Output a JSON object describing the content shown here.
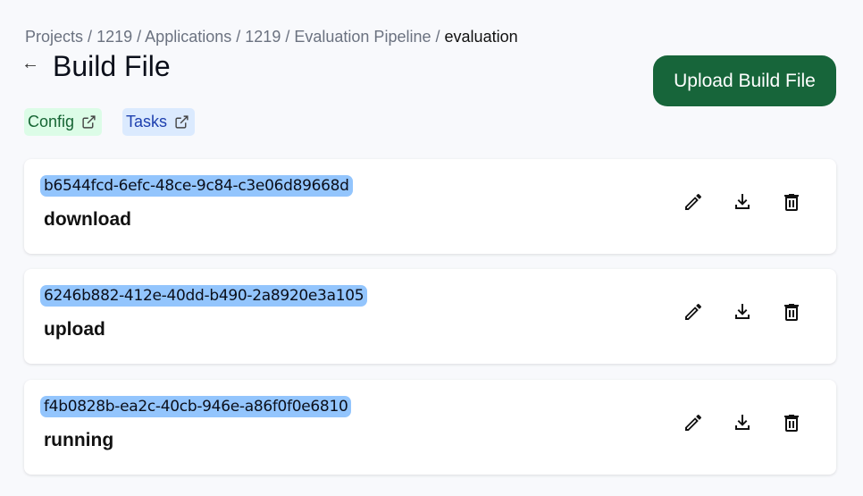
{
  "breadcrumb": [
    {
      "label": "Projects"
    },
    {
      "label": "1219"
    },
    {
      "label": "Applications"
    },
    {
      "label": "1219"
    },
    {
      "label": "Evaluation Pipeline"
    }
  ],
  "breadcrumb_separator": "/",
  "breadcrumb_current": "evaluation",
  "back_icon": "←",
  "title": "Build File",
  "upload_label": "Upload Build File",
  "tags": [
    {
      "label": "Config",
      "icon": "external-link-icon"
    },
    {
      "label": "Tasks",
      "icon": "external-link-icon"
    }
  ],
  "build_files": [
    {
      "id": "b6544fcd-6efc-48ce-9c84-c3e06d89668d",
      "name": "download"
    },
    {
      "id": "6246b882-412e-40dd-b490-2a8920e3a105",
      "name": "upload"
    },
    {
      "id": "f4b0828b-ea2c-40cb-946e-a86f0f0e6810",
      "name": "running"
    }
  ],
  "colors": {
    "primary": "#17653a",
    "id_highlight": "#93c5fd",
    "config_tag": "#dcfce7",
    "tasks_tag": "#dbeafe"
  }
}
